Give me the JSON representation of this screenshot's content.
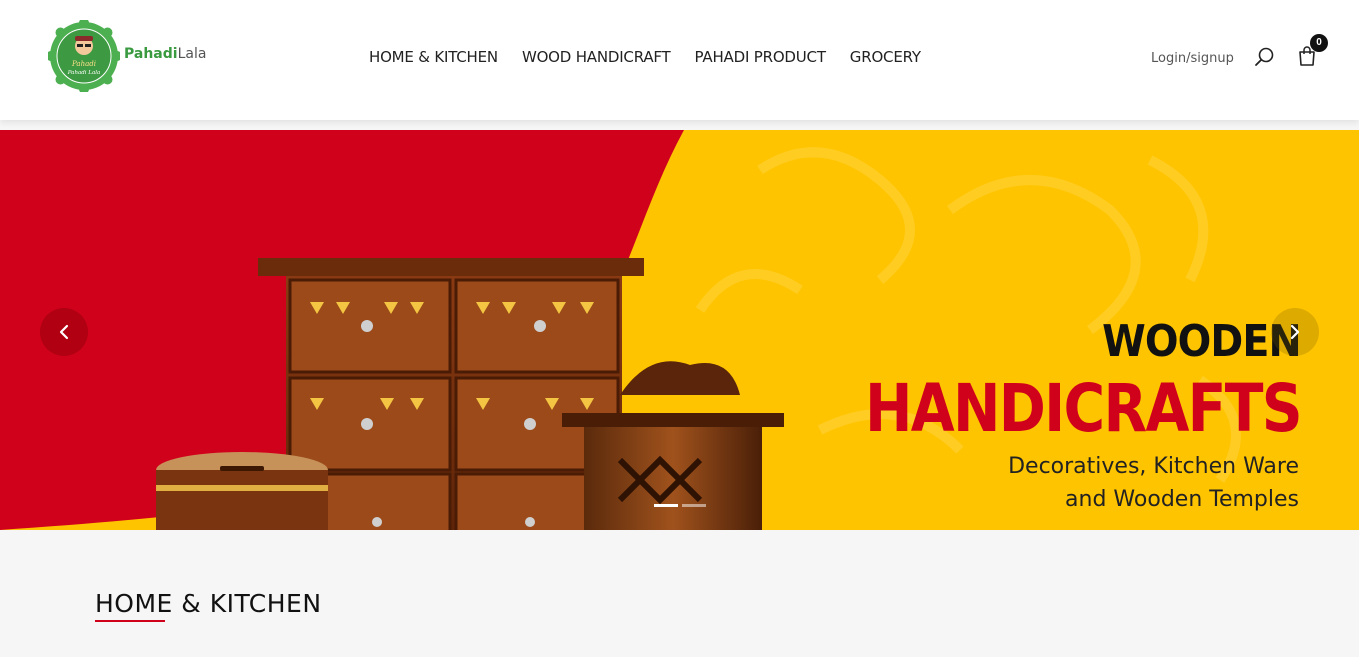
{
  "header": {
    "brand_part1": "Pahadi",
    "brand_part2": "Lala",
    "logo_text_top": "Pahadi",
    "logo_text_bottom": "Pahadi Lala",
    "nav": [
      "HOME & KITCHEN",
      "WOOD HANDICRAFT",
      "PAHADI PRODUCT",
      "GROCERY"
    ],
    "login_label": "Login/signup",
    "search_icon": "search-icon",
    "cart_icon": "shopping-bag-icon",
    "cart_count": "0"
  },
  "banner": {
    "headline1": "WOODEN",
    "headline2": "HANDICRAFTS",
    "subline1": "Decoratives, Kitchen Ware",
    "subline2": "and Wooden Temples",
    "prev_icon": "chevron-left-icon",
    "next_icon": "chevron-right-icon",
    "slides_count": 2,
    "active_slide": 1,
    "colors": {
      "red": "#d0021b",
      "yellow": "#ffc400"
    }
  },
  "section": {
    "title": "HOME & KITCHEN",
    "accent": "#d0021b"
  }
}
